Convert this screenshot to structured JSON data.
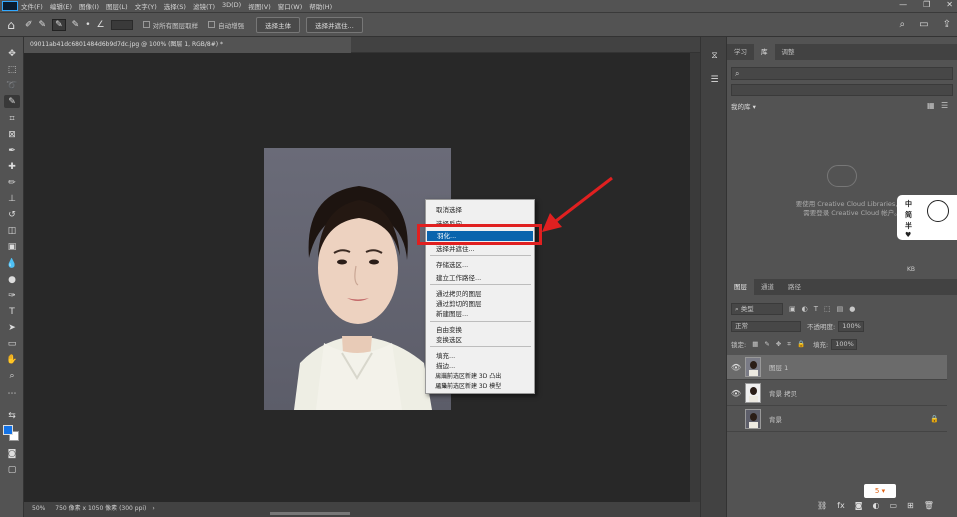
{
  "menubar": {
    "items": [
      "文件(F)",
      "编辑(E)",
      "图像(I)",
      "图层(L)",
      "文字(Y)",
      "选择(S)",
      "滤镜(T)",
      "3D(D)",
      "视图(V)",
      "窗口(W)",
      "帮助(H)"
    ],
    "window_controls": [
      "—",
      "❐",
      "✕"
    ]
  },
  "options": {
    "sample_all_label": "对所有图层取样",
    "auto_enhance_label": "自动增强",
    "select_subject_label": "选择主体",
    "select_mask_label": "选择并遮住..."
  },
  "document": {
    "tab_title": "09011ab41dc6801484d6b9d7dc.jpg @ 100% (图层 1, RGB/8#) *",
    "status_zoom": "50%",
    "status_info": "750 像素 x 1050 像素 (300 ppi)"
  },
  "context_menu": {
    "items": [
      {
        "label": "取消选择",
        "disabled": false
      },
      {
        "label": "选择反向",
        "disabled": false
      },
      {
        "label": "羽化...",
        "disabled": false,
        "highlighted": true
      },
      {
        "label": "选择并遮住...",
        "disabled": false
      },
      {
        "label": "存储选区...",
        "disabled": false
      },
      {
        "label": "建立工作路径...",
        "disabled": false
      },
      {
        "label": "通过拷贝的图层",
        "disabled": false
      },
      {
        "label": "通过剪切的图层",
        "disabled": false
      },
      {
        "label": "新建图层...",
        "disabled": false
      },
      {
        "label": "自由变换",
        "disabled": false
      },
      {
        "label": "变换选区",
        "disabled": false
      },
      {
        "label": "填充...",
        "disabled": false
      },
      {
        "label": "描边...",
        "disabled": false
      },
      {
        "label": "渐隐",
        "disabled": true
      },
      {
        "label": "渲染",
        "disabled": false
      },
      {
        "label": "从当前选区新建 3D 凸出",
        "disabled": false
      },
      {
        "label": "从当前选区新建 3D 模型",
        "disabled": false
      }
    ]
  },
  "libraries_panel": {
    "tabs": [
      "学习",
      "库",
      "调整"
    ],
    "dropdown_label": "我的库",
    "empty_message_1": "要使用 Creative Cloud Libraries，您",
    "empty_message_2": "需要登录 Creative Cloud 帐户。",
    "kb_label": "KB"
  },
  "layers_panel": {
    "tabs": [
      "图层",
      "通道",
      "路径"
    ],
    "kind_label": "类型",
    "blend_mode": "正常",
    "opacity_label": "不透明度:",
    "opacity_value": "100%",
    "lock_label": "锁定:",
    "fill_label": "填充:",
    "fill_value": "100%",
    "layers": [
      {
        "name": "图层 1",
        "selected": true
      },
      {
        "name": "背景 拷贝",
        "selected": false
      },
      {
        "name": "背景",
        "selected": false
      }
    ]
  },
  "widget": {
    "line1": "中",
    "line2": "简",
    "line3": "半"
  },
  "sohu_label": "5"
}
